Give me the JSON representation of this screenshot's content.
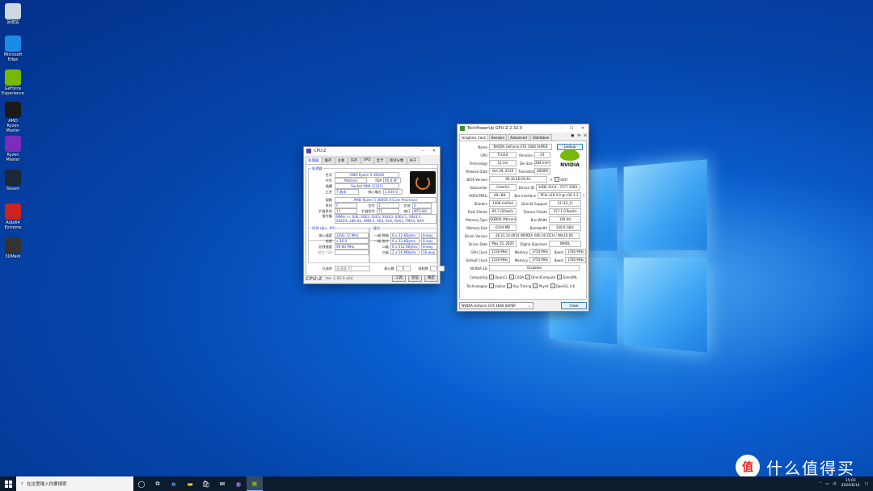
{
  "desktop": {
    "icons": [
      {
        "label": "回收站",
        "color": "#cfd8e3"
      },
      {
        "label": "Microsoft Edge",
        "color": "#1e8ae8"
      },
      {
        "label": "GeForce Experience",
        "color": "#76b900"
      },
      {
        "label": "AMD Ryzen Master",
        "color": "#1a1a1a"
      },
      {
        "label": "Ryzen Master",
        "color": "#7a2dbd"
      },
      {
        "label": "Steam",
        "color": "#1b2838"
      },
      {
        "label": "Aida64 Extreme",
        "color": "#cc2222"
      },
      {
        "label": "3DMark",
        "color": "#333333"
      }
    ]
  },
  "cpuz": {
    "title": "CPU-Z",
    "tabs": [
      "处理器",
      "缓存",
      "主板",
      "内存",
      "SPD",
      "显卡",
      "测试分数",
      "关于"
    ],
    "processor_group": "处理器",
    "name_label": "名字",
    "name": "AMD Ryzen 5 3600X",
    "codename_label": "代号",
    "codename": "Matisse",
    "tdp_label": "TDP",
    "tdp": "95.0 W",
    "socket_label": "插槽",
    "socket": "Socket AM4 (1331)",
    "tech_label": "工艺",
    "tech": "7 纳米",
    "vcore_label": "核心电压",
    "vcore": "1.436 V",
    "spec_label": "规格",
    "spec": "AMD Ryzen 5 3600X 6-Core Processor",
    "family_label": "系列",
    "family": "F",
    "model_label": "型号",
    "model": "1",
    "stepping_label": "步进",
    "stepping": "0",
    "extfamily_label": "扩展系列",
    "extfamily": "17",
    "extmodel_label": "扩展型号",
    "extmodel": "71",
    "revision_label": "修订",
    "revision": "MTS-B0",
    "instr_label": "指令集",
    "instr": "MMX(+), SSE, SSE2, SSE3, SSSE3, SSE4.1, SSE4.2, SSE4A, x86-64, AMD-V, AES, AVX, AVX2, FMA3, SHA",
    "clocks_group": "时钟 (核心 #0)",
    "corespeed_label": "核心速度",
    "corespeed": "3392.72 MHz",
    "mult_label": "倍频",
    "mult": "x 36.0",
    "bus_label": "总线速度",
    "bus": "99.80 MHz",
    "fsb_label": "额定 FSB",
    "fsb": "",
    "cache_group": "缓存",
    "l1d_label": "一级 数据",
    "l1d": "6 x 32 KBytes",
    "l1d_way": "8-way",
    "l1i_label": "一级 指令",
    "l1i": "6 x 32 KBytes",
    "l1i_way": "8-way",
    "l2_label": "二级",
    "l2": "6 x 512 KBytes",
    "l2_way": "8-way",
    "l3_label": "三级",
    "l3": "2 x 16 MBytes",
    "l3_way": "16-way",
    "selected_label": "已选择",
    "selected": "处理器 #1",
    "cores_label": "核心数",
    "cores": "6",
    "threads_label": "线程数",
    "threads": "6",
    "brand": "CPU-Z",
    "version": "Ver. 1.92.0.x64",
    "tools_btn": "工具",
    "validate_btn": "验证",
    "ok_btn": "确定"
  },
  "gpuz": {
    "title": "TechPowerUp GPU-Z 2.32.0",
    "tabs": [
      "Graphics Card",
      "Sensors",
      "Advanced",
      "Validation"
    ],
    "rows": {
      "name": {
        "label": "Name",
        "value": "NVIDIA GeForce GTX 1660 SUPER",
        "btn": "Lookup"
      },
      "gpu": {
        "label": "GPU",
        "value": "TU116",
        "label2": "Revision",
        "value2": "A1"
      },
      "tech": {
        "label": "Technology",
        "value": "12 nm",
        "label2": "Die Size",
        "value2": "284 mm²"
      },
      "release": {
        "label": "Release Date",
        "value": "Oct 29, 2019",
        "label2": "Transistors",
        "value2": "6600M"
      },
      "bios": {
        "label": "BIOS Version",
        "value": "90.16.4D.00.4C",
        "uefi": "UEFI"
      },
      "subvendor": {
        "label": "Subvendor",
        "value": "Colorful",
        "label2": "Device ID",
        "value2": "10DE 21C4 - 7377 1569"
      },
      "rops": {
        "label": "ROPs/TMUs",
        "value": "48 / 88",
        "label2": "Bus Interface",
        "value2": "PCIe x16 3.0 @ x16 1.1"
      },
      "shaders": {
        "label": "Shaders",
        "value": "1408 Unified",
        "label2": "DirectX Support",
        "value2": "12 (12_1)"
      },
      "pixel": {
        "label": "Pixel Fillrate",
        "value": "85.7 GPixel/s",
        "label2": "Texture Fillrate",
        "value2": "157.1 GTexel/s"
      },
      "memtype": {
        "label": "Memory Type",
        "value": "GDDR6 (Micron)",
        "label2": "Bus Width",
        "value2": "192 bit"
      },
      "memsize": {
        "label": "Memory Size",
        "value": "6144 MB",
        "label2": "Bandwidth",
        "value2": "336.0 GB/s"
      },
      "driver": {
        "label": "Driver Version",
        "value": "26.21.14.4614 (NVIDIA 446.14) DCH / Win10 64"
      },
      "driverdate": {
        "label": "Driver Date",
        "value": "May 15, 2020",
        "label2": "Digital Signature",
        "value2": "WHQL"
      },
      "gpuclock": {
        "label": "GPU Clock",
        "value": "1530 MHz",
        "label2": "Memory",
        "value2": "1750 MHz",
        "label3": "Boost",
        "value3": "1785 MHz"
      },
      "defclock": {
        "label": "Default Clock",
        "value": "1530 MHz",
        "label2": "Memory",
        "value2": "1750 MHz",
        "label3": "Boost",
        "value3": "1785 MHz"
      },
      "sli": {
        "label": "NVIDIA SLI",
        "value": "Disabled"
      },
      "computing": {
        "label": "Computing",
        "items": [
          "OpenCL",
          "CUDA",
          "DirectCompute",
          "DirectML"
        ]
      },
      "technologies": {
        "label": "Technologies",
        "items": [
          "Vulkan",
          "Ray Tracing",
          "PhysX",
          "OpenGL 4.6"
        ]
      }
    },
    "selected_gpu": "NVIDIA GeForce GTX 1660 SUPER",
    "close_btn": "Close",
    "nvidia_text": "NVIDIA"
  },
  "taskbar": {
    "search_placeholder": "在这里输入你要搜索",
    "time": "15:03",
    "date": "2020/6/14"
  },
  "watermark": {
    "symbol": "值",
    "text": "什么值得买"
  }
}
